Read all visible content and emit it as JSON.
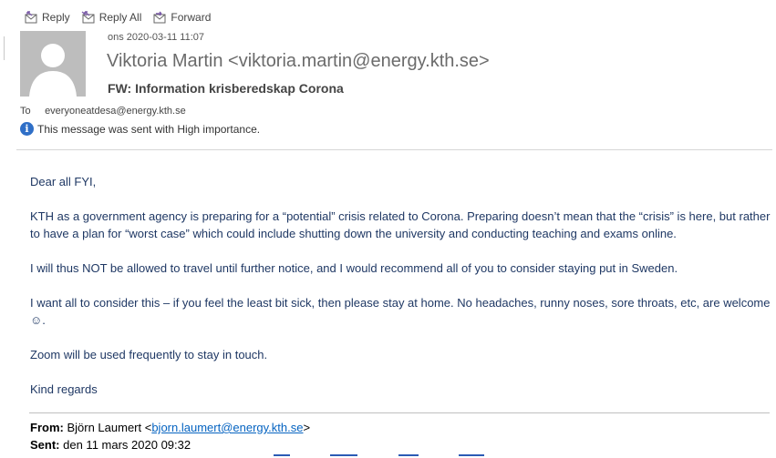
{
  "toolbar": {
    "reply_label": "Reply",
    "reply_all_label": "Reply All",
    "forward_label": "Forward"
  },
  "message": {
    "date": "ons 2020-03-11 11:07",
    "sender": "Viktoria Martin <viktoria.martin@energy.kth.se>",
    "subject": "FW: Information krisberedskap Corona",
    "to_label": "To",
    "to_value": "everyoneatdesa@energy.kth.se",
    "importance_text": "This message was sent with High importance."
  },
  "body": {
    "paragraphs": [
      "Dear all FYI,",
      "KTH as a government agency is preparing for a “potential” crisis related to Corona. Preparing doesn’t mean that the “crisis” is here, but rather to have a plan for “worst case” which could include shutting down the university and conducting teaching and exams online.",
      "I will thus NOT be allowed to travel until further notice, and I would recommend all of you to consider staying put in Sweden.",
      "I want all to consider this – if you feel the least bit sick, then please stay at home. No headaches, runny noses, sore throats, etc, are welcome ☺.",
      "Zoom will be used frequently to stay in touch.",
      "Kind regards"
    ]
  },
  "quoted": {
    "from_label": "From:",
    "from_name": "Björn Laumert <",
    "from_email": "bjorn.laumert@energy.kth.se",
    "from_close": ">",
    "sent_label": "Sent:",
    "sent_value": "den 11 mars 2020 09:32"
  },
  "colors": {
    "body_text": "#1f3864",
    "link": "#0563c1",
    "info_icon": "#2f6fc7"
  }
}
